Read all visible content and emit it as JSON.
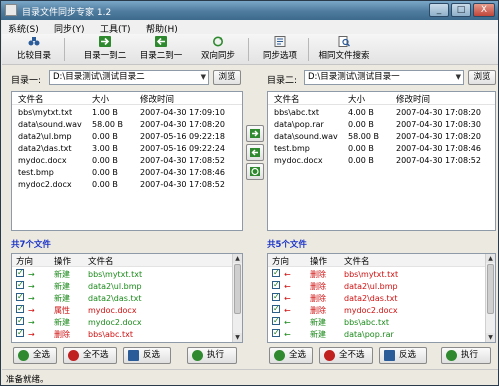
{
  "window": {
    "title": "目录文件同步专家 1.2"
  },
  "titlebar_buttons": {
    "minimize": "_",
    "maximize": "□",
    "close": "X"
  },
  "menu": [
    "系统(S)",
    "同步(Y)",
    "工具(T)",
    "帮助(H)"
  ],
  "toolbar": [
    {
      "label": "比较目录",
      "icon": "binoculars-icon"
    },
    {
      "label": "目录一到二",
      "icon": "arrow-right-icon"
    },
    {
      "label": "目录二到一",
      "icon": "arrow-left-icon"
    },
    {
      "label": "双向同步",
      "icon": "sync-icon"
    },
    {
      "label": "同步选项",
      "icon": "options-icon"
    },
    {
      "label": "相同文件搜索",
      "icon": "search-file-icon"
    }
  ],
  "left": {
    "dir_label": "目录一:",
    "dir_value": "D:\\目录测试\\测试目录二",
    "browse": "浏览",
    "headers": {
      "name": "文件名",
      "size": "大小",
      "time": "修改时间"
    },
    "files": [
      {
        "name": "bbs\\mytxt.txt",
        "size": "1.00 B",
        "time": "2007-04-30 17:09:10"
      },
      {
        "name": "data\\sound.wav",
        "size": "58.00 B",
        "time": "2007-04-30 17:08:20"
      },
      {
        "name": "data2\\ul.bmp",
        "size": "0.00 B",
        "time": "2007-05-16 09:22:18"
      },
      {
        "name": "data2\\das.txt",
        "size": "3.00 B",
        "time": "2007-05-16 09:22:24"
      },
      {
        "name": "mydoc.docx",
        "size": "0.00 B",
        "time": "2007-04-30 17:08:52"
      },
      {
        "name": "test.bmp",
        "size": "0.00 B",
        "time": "2007-04-30 17:08:46"
      },
      {
        "name": "mydoc2.docx",
        "size": "0.00 B",
        "time": "2007-04-30 17:08:52"
      }
    ],
    "count": "共7个文件",
    "op_headers": {
      "dir": "方向",
      "op": "操作",
      "name": "文件名"
    },
    "ops": [
      {
        "dir": "→",
        "op": "新建",
        "name": "bbs\\mytxt.txt",
        "color": "#1a8a1a"
      },
      {
        "dir": "→",
        "op": "新建",
        "name": "data2\\ul.bmp",
        "color": "#1a8a1a"
      },
      {
        "dir": "→",
        "op": "新建",
        "name": "data2\\das.txt",
        "color": "#1a8a1a"
      },
      {
        "dir": "→",
        "op": "属性",
        "name": "mydoc.docx",
        "color": "#d01010"
      },
      {
        "dir": "→",
        "op": "新建",
        "name": "mydoc2.docx",
        "color": "#1a8a1a"
      },
      {
        "dir": "→",
        "op": "删除",
        "name": "bbs\\abc.txt",
        "color": "#d01010"
      }
    ],
    "buttons": {
      "select_all": "全选",
      "select_none": "全不选",
      "invert": "反选",
      "execute": "执行"
    }
  },
  "right": {
    "dir_label": "目录二:",
    "dir_value": "D:\\目录测试\\测试目录一",
    "browse": "浏览",
    "headers": {
      "name": "文件名",
      "size": "大小",
      "time": "修改时间"
    },
    "files": [
      {
        "name": "bbs\\abc.txt",
        "size": "4.00 B",
        "time": "2007-04-30 17:08:20"
      },
      {
        "name": "data\\pop.rar",
        "size": "0.00 B",
        "time": "2007-04-30 17:08:30"
      },
      {
        "name": "data\\sound.wav",
        "size": "58.00 B",
        "time": "2007-04-30 17:08:20"
      },
      {
        "name": "test.bmp",
        "size": "0.00 B",
        "time": "2007-04-30 17:08:46"
      },
      {
        "name": "mydoc.docx",
        "size": "0.00 B",
        "time": "2007-04-30 17:08:52"
      }
    ],
    "count": "共5个文件",
    "op_headers": {
      "dir": "方向",
      "op": "操作",
      "name": "文件名"
    },
    "ops": [
      {
        "dir": "←",
        "op": "删除",
        "name": "bbs\\mytxt.txt",
        "color": "#d01010"
      },
      {
        "dir": "←",
        "op": "删除",
        "name": "data2\\ul.bmp",
        "color": "#d01010"
      },
      {
        "dir": "←",
        "op": "删除",
        "name": "data2\\das.txt",
        "color": "#d01010"
      },
      {
        "dir": "←",
        "op": "删除",
        "name": "mydoc2.docx",
        "color": "#d01010"
      },
      {
        "dir": "←",
        "op": "新建",
        "name": "bbs\\abc.txt",
        "color": "#1a8a1a"
      },
      {
        "dir": "←",
        "op": "新建",
        "name": "data\\pop.rar",
        "color": "#1a8a1a"
      }
    ],
    "buttons": {
      "select_all": "全选",
      "select_none": "全不选",
      "invert": "反选",
      "execute": "执行"
    }
  },
  "status": "准备就绪。"
}
